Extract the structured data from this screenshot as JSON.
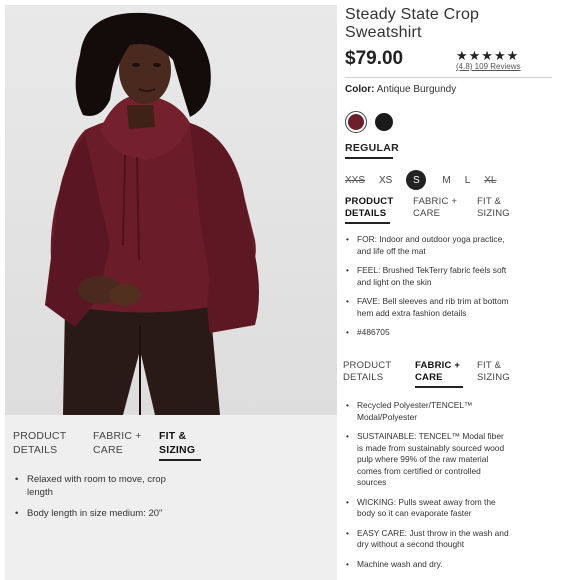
{
  "product": {
    "title": "Steady State Crop Sweatshirt",
    "price": "$79.00",
    "stars": "★★★★★",
    "reviews": "(4.8) 109 Reviews"
  },
  "color": {
    "label": "Color:",
    "value": "Antique Burgundy",
    "swatches": [
      {
        "name": "Antique Burgundy",
        "hex": "#6e1f2c",
        "selected": true
      },
      {
        "name": "Black",
        "hex": "#1b1b1b",
        "selected": false
      }
    ]
  },
  "size_type": "REGULAR",
  "sizes": [
    {
      "label": "XXS",
      "state": "unavailable"
    },
    {
      "label": "XS",
      "state": "available"
    },
    {
      "label": "S",
      "state": "selected"
    },
    {
      "label": "M",
      "state": "available"
    },
    {
      "label": "L",
      "state": "available"
    },
    {
      "label": "XL",
      "state": "unavailable"
    }
  ],
  "tabs": {
    "product_details": "PRODUCT\nDETAILS",
    "fabric_care": "FABRIC +\nCARE",
    "fit_sizing": "FIT &\nSIZING"
  },
  "product_details_bullets": [
    "FOR: Indoor and outdoor yoga practice, and life off the mat",
    "FEEL: Brushed TekTerry fabric feels soft and light on the skin",
    "FAVE: Bell sleeves and rib trim at bottom hem add extra fashion details",
    "#486705"
  ],
  "fabric_care_bullets": [
    "Recycled Polyester/TENCEL™ Modal/Polyester",
    "SUSTAINABLE: TENCEL™ Modal fiber is made from sustainably sourced wood pulp where 99% of the raw material comes from certified or controlled sources",
    "WICKING: Pulls sweat away from the body so it can evaporate faster",
    "EASY CARE: Just throw in the wash and dry without a second thought",
    "Machine wash and dry."
  ],
  "fit_sizing_bullets": [
    "Relaxed with room to move, crop length",
    "Body length in size medium: 20\""
  ],
  "colors": {
    "burgundy": "#6e1f2c",
    "accent": "#222222",
    "panel_bg": "#efefef"
  }
}
